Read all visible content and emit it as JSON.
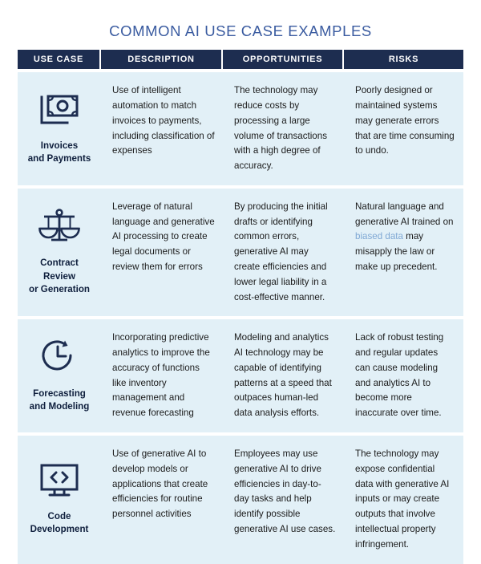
{
  "title": "COMMON AI USE CASE EXAMPLES",
  "colors": {
    "title": "#3a5ba0",
    "header_bg": "#1d2d50",
    "header_text": "#ffffff",
    "row_bg": "#e2f0f7",
    "body_text": "#1b1b1b",
    "usecase_label": "#0f1f3d",
    "link": "#7fa8d4",
    "page_bg": "#ffffff"
  },
  "table": {
    "columns": [
      {
        "key": "use_case",
        "label": "USE CASE"
      },
      {
        "key": "description",
        "label": "DESCRIPTION"
      },
      {
        "key": "opportunities",
        "label": "OPPORTUNITIES"
      },
      {
        "key": "risks",
        "label": "RISKS"
      }
    ],
    "rows": [
      {
        "icon": "banknote-icon",
        "use_case": "Invoices\nand Payments",
        "description": "Use of intelligent automation to match invoices to payments, including classification of expenses",
        "opportunities": "The technology may reduce costs by processing a large volume of transactions with a high degree of accuracy.",
        "risks_before_link": "Poorly designed or maintained systems may generate errors that are time consuming to undo.",
        "risks_link": "",
        "risks_after_link": ""
      },
      {
        "icon": "scales-of-justice-icon",
        "use_case": "Contract Review\nor Generation",
        "description": "Leverage of natural language and generative AI processing to create legal documents or review them for errors",
        "opportunities": "By producing the initial drafts or identifying common errors, generative AI may create efficiencies and lower legal liability in a cost-effective manner.",
        "risks_before_link": "Natural language and generative AI trained on ",
        "risks_link": "biased data",
        "risks_after_link": " may misapply the law or make up precedent."
      },
      {
        "icon": "clock-forecast-icon",
        "use_case": "Forecasting\nand Modeling",
        "description": "Incorporating predictive analytics to improve the accuracy of functions like inventory management and revenue forecasting",
        "opportunities": "Modeling and analytics AI technology may be capable of identifying patterns at a speed that outpaces human-led data analysis efforts.",
        "risks_before_link": "Lack of robust testing and regular updates can cause modeling and analytics AI to become more inaccurate over time.",
        "risks_link": "",
        "risks_after_link": ""
      },
      {
        "icon": "monitor-code-icon",
        "use_case": "Code\nDevelopment",
        "description": "Use of generative AI to develop models or applications that create efficiencies for routine personnel activities",
        "opportunities": "Employees may use generative AI to drive efficiencies in day-to-day tasks and help identify possible generative AI use cases.",
        "risks_before_link": "The technology may expose confidential data with generative AI inputs or may create outputs that involve intellectual property infringement.",
        "risks_link": "",
        "risks_after_link": ""
      }
    ]
  }
}
